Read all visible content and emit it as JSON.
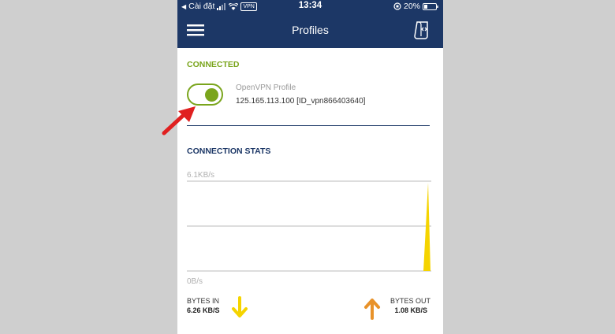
{
  "status_bar": {
    "carrier": "Cài đặt",
    "vpn_badge": "VPN",
    "time": "13:34",
    "battery": "20%"
  },
  "header": {
    "title": "Profiles"
  },
  "connection": {
    "status": "CONNECTED",
    "profile_name": "OpenVPN Profile",
    "profile_address": "125.165.113.100 [ID_vpn866403640]",
    "toggle_on": true
  },
  "stats": {
    "title": "CONNECTION STATS",
    "max_label": "6.1KB/s",
    "min_label": "0B/s",
    "bytes_in_label": "BYTES IN",
    "bytes_in_value": "6.26 KB/S",
    "bytes_out_label": "BYTES OUT",
    "bytes_out_value": "1.08 KB/S"
  },
  "colors": {
    "brand": "#1c3766",
    "connected": "#7aa51c",
    "bytes_in": "#f5d400",
    "bytes_out": "#e8922a",
    "annotation": "#e02020"
  },
  "icons": {
    "menu": "hamburger-icon",
    "import": "import-profile-icon",
    "bytes_in": "arrow-down-icon",
    "bytes_out": "arrow-up-icon"
  }
}
